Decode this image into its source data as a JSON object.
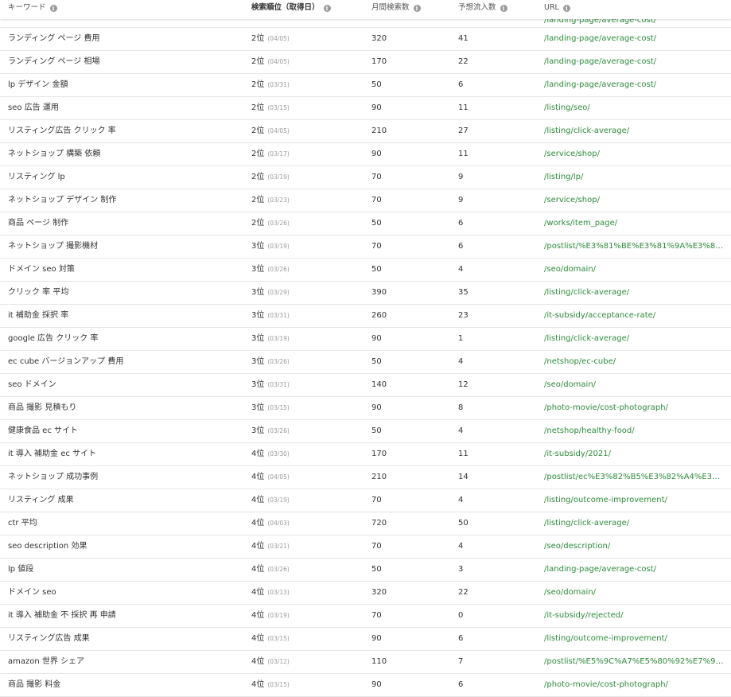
{
  "headers": {
    "keyword": "キーワード",
    "rank": "検索順位（取得日）",
    "volume": "月間検索数",
    "traffic": "予想流入数",
    "url": "URL"
  },
  "partial_row_url": "/landing-page/average-cost/",
  "rows": [
    {
      "keyword": "ランディング ページ 費用",
      "rank": "2位",
      "date": "(04/05)",
      "volume": "320",
      "traffic": "41",
      "url": "/landing-page/average-cost/"
    },
    {
      "keyword": "ランディング ページ 相場",
      "rank": "2位",
      "date": "(04/05)",
      "volume": "170",
      "traffic": "22",
      "url": "/landing-page/average-cost/"
    },
    {
      "keyword": "lp デザイン 金額",
      "rank": "2位",
      "date": "(03/31)",
      "volume": "50",
      "traffic": "6",
      "url": "/landing-page/average-cost/"
    },
    {
      "keyword": "seo 広告 運用",
      "rank": "2位",
      "date": "(03/15)",
      "volume": "90",
      "traffic": "11",
      "url": "/listing/seo/"
    },
    {
      "keyword": "リスティング広告 クリック 率",
      "rank": "2位",
      "date": "(04/05)",
      "volume": "210",
      "traffic": "27",
      "url": "/listing/click-average/"
    },
    {
      "keyword": "ネットショップ 構築 依頼",
      "rank": "2位",
      "date": "(03/17)",
      "volume": "90",
      "traffic": "11",
      "url": "/service/shop/"
    },
    {
      "keyword": "リスティング lp",
      "rank": "2位",
      "date": "(03/19)",
      "volume": "70",
      "traffic": "9",
      "url": "/listing/lp/"
    },
    {
      "keyword": "ネットショップ デザイン 制作",
      "rank": "2位",
      "date": "(03/23)",
      "volume": "70",
      "traffic": "9",
      "url": "/service/shop/"
    },
    {
      "keyword": "商品 ページ 制作",
      "rank": "2位",
      "date": "(03/26)",
      "volume": "50",
      "traffic": "6",
      "url": "/works/item_page/"
    },
    {
      "keyword": "ネットショップ 撮影機材",
      "rank": "3位",
      "date": "(03/19)",
      "volume": "70",
      "traffic": "6",
      "url": "/postlist/%E3%81%BE%E3%81%9A%E3%81…"
    },
    {
      "keyword": "ドメイン seo 対策",
      "rank": "3位",
      "date": "(03/26)",
      "volume": "50",
      "traffic": "4",
      "url": "/seo/domain/"
    },
    {
      "keyword": "クリック 率 平均",
      "rank": "3位",
      "date": "(03/29)",
      "volume": "390",
      "traffic": "35",
      "url": "/listing/click-average/"
    },
    {
      "keyword": "it 補助金 採択 率",
      "rank": "3位",
      "date": "(03/31)",
      "volume": "260",
      "traffic": "23",
      "url": "/it-subsidy/acceptance-rate/"
    },
    {
      "keyword": "google 広告 クリック 率",
      "rank": "3位",
      "date": "(03/19)",
      "volume": "90",
      "traffic": "1",
      "url": "/listing/click-average/"
    },
    {
      "keyword": "ec cube バージョンアップ 費用",
      "rank": "3位",
      "date": "(03/26)",
      "volume": "50",
      "traffic": "4",
      "url": "/netshop/ec-cube/"
    },
    {
      "keyword": "seo ドメイン",
      "rank": "3位",
      "date": "(03/31)",
      "volume": "140",
      "traffic": "12",
      "url": "/seo/domain/"
    },
    {
      "keyword": "商品 撮影 見積もり",
      "rank": "3位",
      "date": "(03/15)",
      "volume": "90",
      "traffic": "8",
      "url": "/photo-movie/cost-photograph/"
    },
    {
      "keyword": "健康食品 ec サイト",
      "rank": "3位",
      "date": "(03/26)",
      "volume": "50",
      "traffic": "4",
      "url": "/netshop/healthy-food/"
    },
    {
      "keyword": "it 導入 補助金 ec サイト",
      "rank": "4位",
      "date": "(03/30)",
      "volume": "170",
      "traffic": "11",
      "url": "/it-subsidy/2021/"
    },
    {
      "keyword": "ネットショップ 成功事例",
      "rank": "4位",
      "date": "(04/05)",
      "volume": "210",
      "traffic": "14",
      "url": "/postlist/ec%E3%82%B5%E3%82%A4%E3%…"
    },
    {
      "keyword": "リスティング 成果",
      "rank": "4位",
      "date": "(03/19)",
      "volume": "70",
      "traffic": "4",
      "url": "/listing/outcome-improvement/"
    },
    {
      "keyword": "ctr 平均",
      "rank": "4位",
      "date": "(04/03)",
      "volume": "720",
      "traffic": "50",
      "url": "/listing/click-average/"
    },
    {
      "keyword": "seo description 効果",
      "rank": "4位",
      "date": "(03/21)",
      "volume": "70",
      "traffic": "4",
      "url": "/seo/description/"
    },
    {
      "keyword": "lp 値段",
      "rank": "4位",
      "date": "(03/26)",
      "volume": "50",
      "traffic": "3",
      "url": "/landing-page/average-cost/"
    },
    {
      "keyword": "ドメイン seo",
      "rank": "4位",
      "date": "(03/13)",
      "volume": "320",
      "traffic": "22",
      "url": "/seo/domain/"
    },
    {
      "keyword": "it 導入 補助金 不 採択 再 申請",
      "rank": "4位",
      "date": "(03/19)",
      "volume": "70",
      "traffic": "0",
      "url": "/it-subsidy/rejected/"
    },
    {
      "keyword": "リスティング広告 成果",
      "rank": "4位",
      "date": "(03/15)",
      "volume": "90",
      "traffic": "6",
      "url": "/listing/outcome-improvement/"
    },
    {
      "keyword": "amazon 世界 シェア",
      "rank": "4位",
      "date": "(03/12)",
      "volume": "110",
      "traffic": "7",
      "url": "/postlist/%E5%9C%A7%E5%80%92%E7%9A…"
    },
    {
      "keyword": "商品 撮影 料金",
      "rank": "4位",
      "date": "(03/15)",
      "volume": "90",
      "traffic": "6",
      "url": "/photo-movie/cost-photograph/"
    }
  ],
  "colors": {
    "url": "#2e8b3b",
    "border": "#e6e6e6",
    "date": "#9a9a9a"
  },
  "icons": {
    "info": "info-circle-icon"
  }
}
